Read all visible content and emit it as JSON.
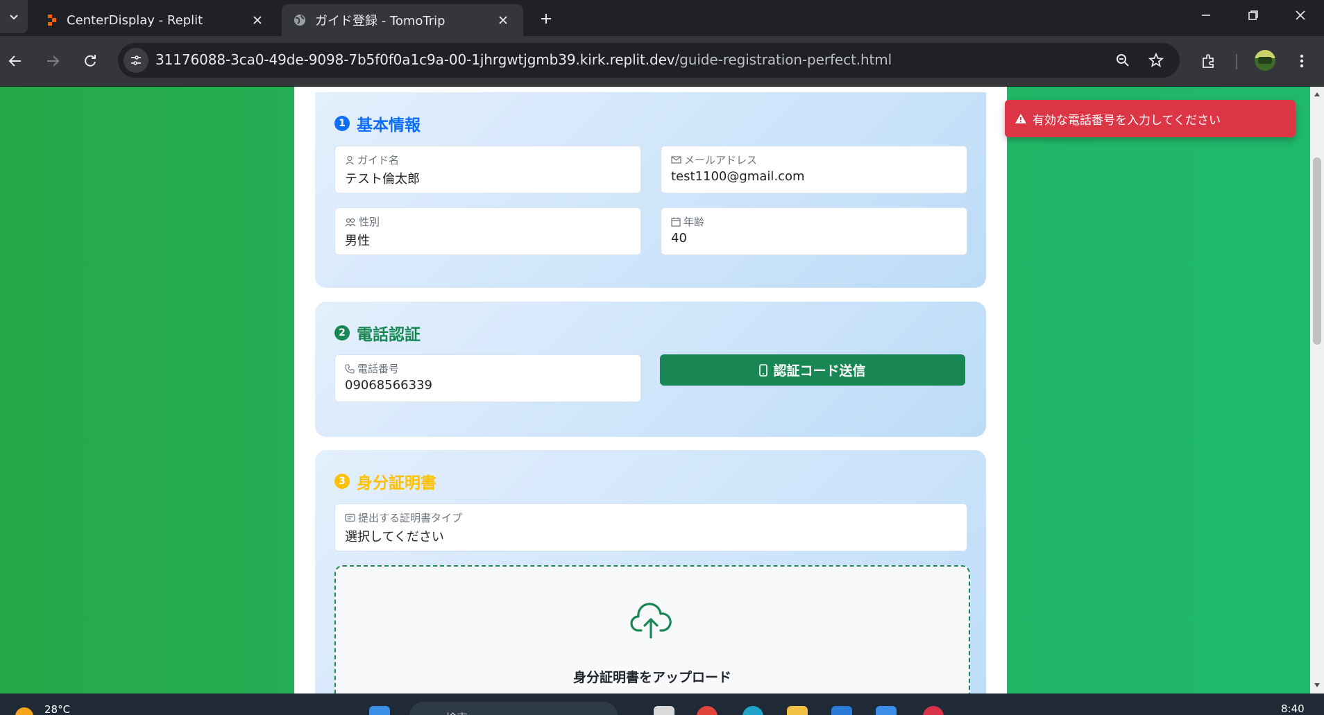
{
  "browser": {
    "tabs": [
      {
        "title": "CenterDisplay - Replit",
        "active": false
      },
      {
        "title": "ガイド登録 - TomoTrip",
        "active": true
      }
    ],
    "url_host": "31176088-3ca0-49de-9098-7b5f0f0a1c9a-00-1jhrgwtjgmb39.kirk.replit.dev",
    "url_path": "/guide-registration-perfect.html"
  },
  "sections": {
    "basic": {
      "number": "1",
      "title": "基本情報",
      "color": "#0d6efd",
      "guide_name_label": "ガイド名",
      "guide_name_value": "テスト倫太郎",
      "email_label": "メールアドレス",
      "email_value": "test1100@gmail.com",
      "gender_label": "性別",
      "gender_value": "男性",
      "age_label": "年齢",
      "age_value": "40"
    },
    "phone": {
      "number": "2",
      "title": "電話認証",
      "color": "#198754",
      "phone_label": "電話番号",
      "phone_value": "09068566339",
      "send_button": "認証コード送信"
    },
    "identity": {
      "number": "3",
      "title": "身分証明書",
      "color": "#ffc107",
      "doc_type_label": "提出する証明書タイプ",
      "doc_type_value": "選択してください",
      "upload_title": "身分証明書をアップロード"
    }
  },
  "toast": {
    "message": "有効な電話番号を入力してください",
    "color": "#dc3545"
  },
  "taskbar": {
    "temperature": "28°C",
    "search_placeholder": "検索",
    "time": "8:40"
  }
}
